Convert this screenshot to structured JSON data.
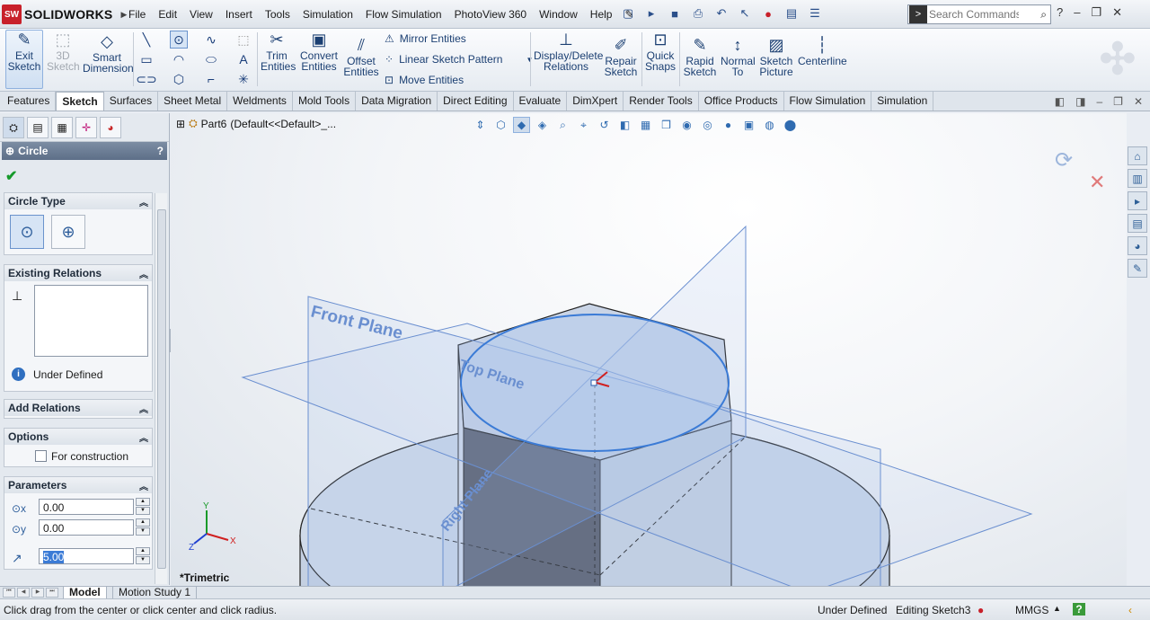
{
  "app": {
    "brand_short": "SW",
    "brand": "SOLIDWORKS"
  },
  "menu": [
    "File",
    "Edit",
    "View",
    "Insert",
    "Tools",
    "Simulation",
    "Flow Simulation",
    "PhotoView 360",
    "Window",
    "Help"
  ],
  "search": {
    "placeholder": "Search Commands"
  },
  "ribbon": {
    "exit_sketch": "Exit Sketch",
    "sketch3d": "3D Sketch",
    "smart_dimension": "Smart Dimension",
    "trim": "Trim Entities",
    "convert": "Convert Entities",
    "offset": "Offset Entities",
    "mirror": "Mirror Entities",
    "linear_pattern": "Linear Sketch Pattern",
    "move": "Move Entities",
    "display_delete": "Display/Delete Relations",
    "repair": "Repair Sketch",
    "quick_snaps": "Quick Snaps",
    "rapid": "Rapid Sketch",
    "normal_to": "Normal To",
    "sketch_picture": "Sketch Picture",
    "centerline": "Centerline"
  },
  "tabs": [
    "Features",
    "Sketch",
    "Surfaces",
    "Sheet Metal",
    "Weldments",
    "Mold Tools",
    "Data Migration",
    "Direct Editing",
    "Evaluate",
    "DimXpert",
    "Render Tools",
    "Office Products",
    "Flow Simulation",
    "Simulation"
  ],
  "active_tab": "Sketch",
  "tree": {
    "part": "Part6",
    "config": "(Default<<Default>_..."
  },
  "pm": {
    "title": "Circle",
    "help": "?",
    "circle_type": {
      "header": "Circle Type"
    },
    "existing_relations": {
      "header": "Existing Relations",
      "status": "Under Defined"
    },
    "add_relations": {
      "header": "Add Relations"
    },
    "options": {
      "header": "Options",
      "construction": "For construction"
    },
    "parameters": {
      "header": "Parameters",
      "cx": "0.00",
      "cy": "0.00",
      "radius": "5.00"
    }
  },
  "viewport": {
    "front_plane": "Front Plane",
    "top_plane": "Top Plane",
    "right_plane": "Right Plane",
    "view_name": "*Trimetric",
    "axis_x": "X",
    "axis_y": "Y",
    "axis_z": "Z"
  },
  "bottom_tabs": [
    "Model",
    "Motion Study 1"
  ],
  "status": {
    "hint": "Click drag from the center or click center and click radius.",
    "state": "Under Defined",
    "editing": "Editing Sketch3",
    "units": "MMGS"
  },
  "colors": {
    "accent": "#3b7bd6",
    "plane": "#6a8fd0",
    "ok": "#169a2b"
  }
}
